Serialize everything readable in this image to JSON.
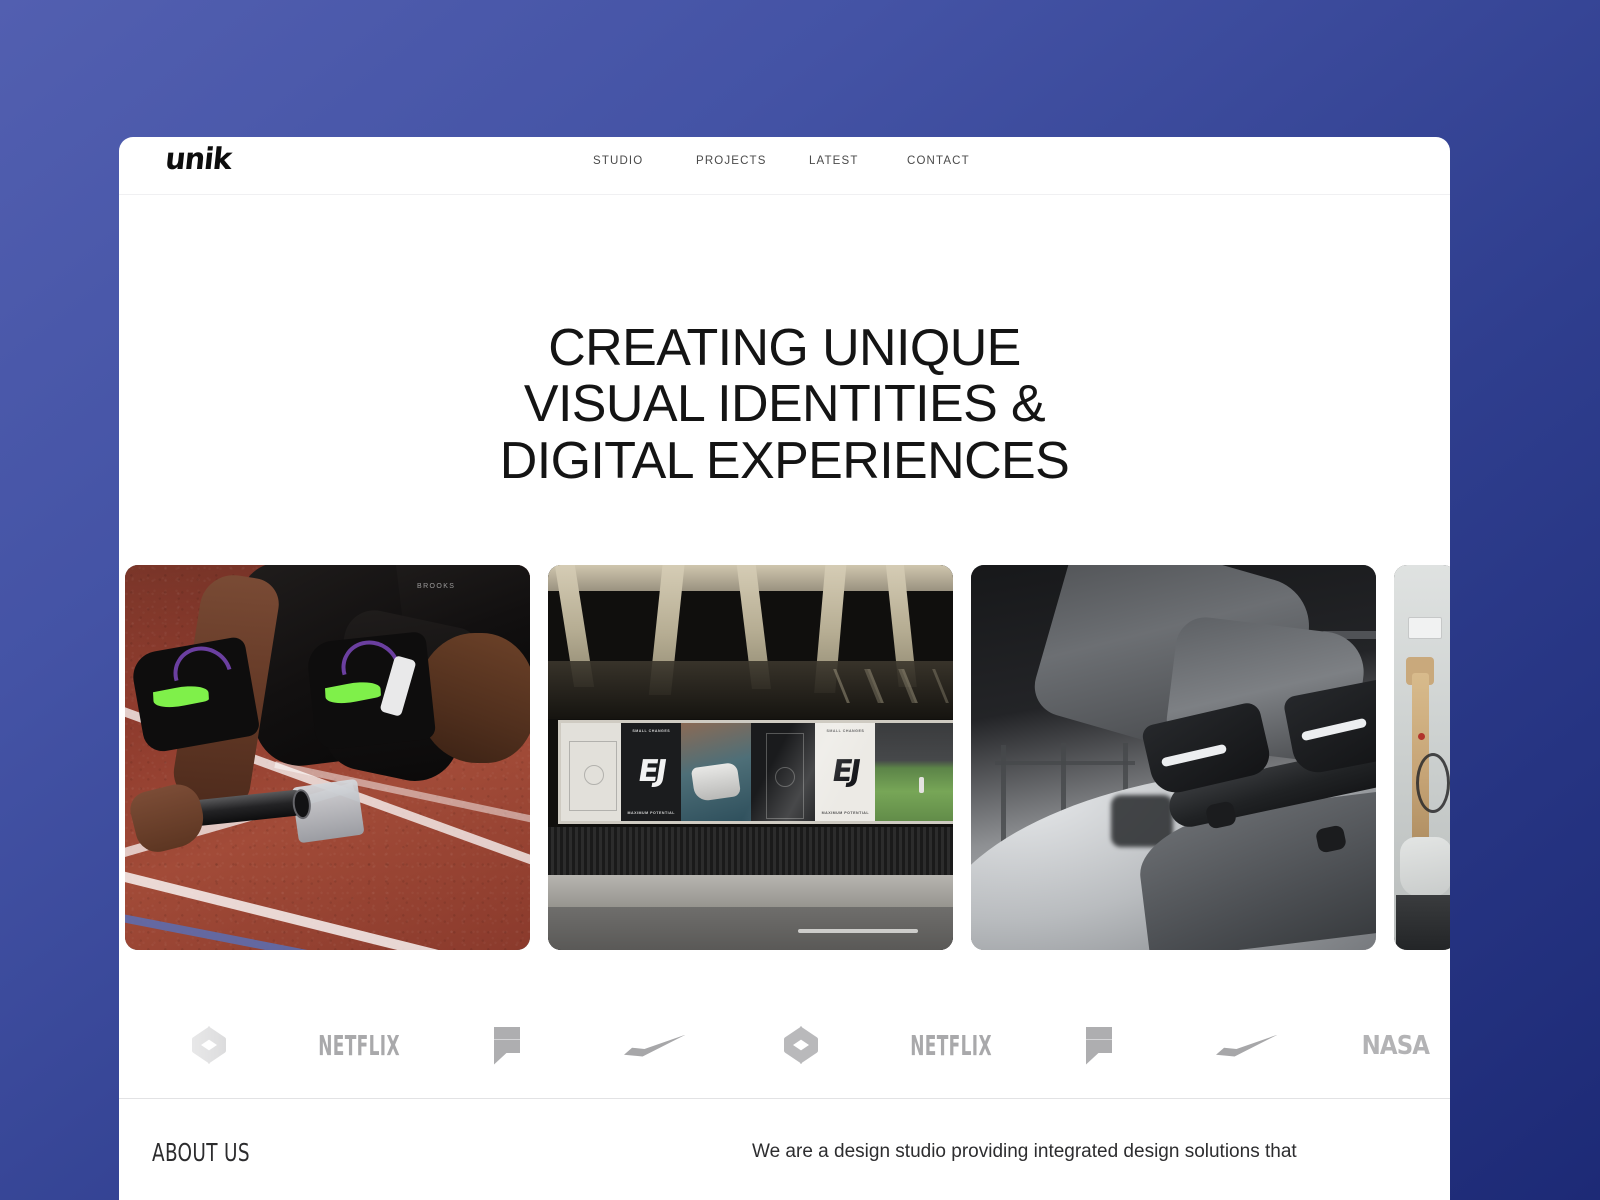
{
  "background": {
    "gradient_from": "#525fb0",
    "gradient_to": "#1d2a76"
  },
  "header": {
    "brand": "unik",
    "nav": [
      {
        "label": "STUDIO"
      },
      {
        "label": "PROJECTS"
      },
      {
        "label": "LATEST"
      },
      {
        "label": "CONTACT"
      }
    ]
  },
  "hero": {
    "title": "CREATING UNIQUE VISUAL IDENTITIES & DIGITAL EXPERIENCES"
  },
  "gallery": {
    "cards": [
      {
        "name": "sprinter-track",
        "alt": "Sprinter in starting blocks holding a relay baton on a red running track",
        "brand_tag": "BROOKS"
      },
      {
        "name": "billboard-campaign",
        "alt": "Outdoor billboard campaign mounted under a steel bridge beside a road",
        "billboard": {
          "caption_top": "SMALL CHANGES",
          "caption_bottom": "MAXIMUM POTENTIAL",
          "mark": "EJ"
        }
      },
      {
        "name": "skateboarder-ramp",
        "alt": "Black and white photo of a skateboarder on the lip of a concrete ramp"
      },
      {
        "name": "guitar-studio",
        "alt": "Electric guitar hanging on a studio wall with cables"
      }
    ]
  },
  "logo_strip": {
    "logos": [
      {
        "name": "dropbox",
        "type": "mark",
        "label": "Dropbox"
      },
      {
        "name": "netflix",
        "type": "wordmark",
        "label": "NETFLIX"
      },
      {
        "name": "framer",
        "type": "mark",
        "label": "Framer"
      },
      {
        "name": "nike",
        "type": "mark",
        "label": "Nike"
      },
      {
        "name": "dropbox",
        "type": "mark",
        "label": "Dropbox"
      },
      {
        "name": "netflix",
        "type": "wordmark",
        "label": "NETFLIX"
      },
      {
        "name": "framer",
        "type": "mark",
        "label": "Framer"
      },
      {
        "name": "nike",
        "type": "mark",
        "label": "Nike"
      },
      {
        "name": "nasa",
        "type": "wordmark",
        "label": "NASA"
      }
    ]
  },
  "about": {
    "label": "ABOUT US",
    "text": "We are a design studio providing integrated design solutions that"
  }
}
